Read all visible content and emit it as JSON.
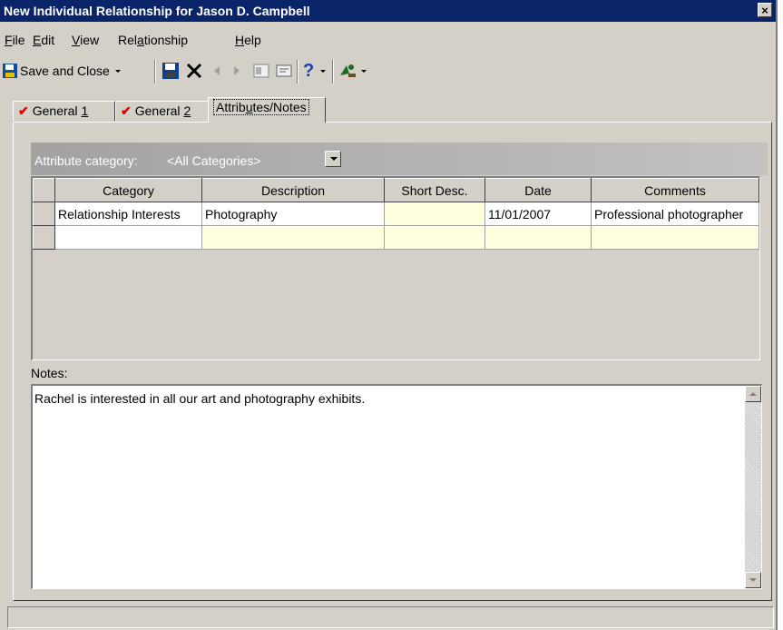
{
  "window": {
    "title": "New Individual Relationship for Jason D. Campbell",
    "close_glyph": "×"
  },
  "menu": [
    {
      "label": "File",
      "u": "F",
      "rest": "ile"
    },
    {
      "label": "Edit",
      "u": "E",
      "rest": "dit"
    },
    {
      "label": "View",
      "u": "V",
      "rest": "iew"
    },
    {
      "label": "Relationship",
      "pre": "Rel",
      "u": "a",
      "rest": "tionship"
    },
    {
      "label": "Help",
      "u": "H",
      "rest": "elp"
    }
  ],
  "toolbar": {
    "save_close_label": "Save and Close",
    "help_glyph": "?"
  },
  "tabs": [
    {
      "label": "General 1",
      "pre": "General ",
      "u": "1"
    },
    {
      "label": "General 2",
      "pre": "General ",
      "u": "2"
    },
    {
      "label": "Attributes/Notes",
      "pre": "Attrib",
      "u": "u",
      "rest": "tes/Notes"
    }
  ],
  "attributes": {
    "category_label": "Attribute category:",
    "category_value": "<All Categories>",
    "columns": [
      "Category",
      "Description",
      "Short Desc.",
      "Date",
      "Comments"
    ],
    "rows": [
      {
        "category": "Relationship Interests",
        "description": "Photography",
        "short_desc": "",
        "date": "11/01/2007",
        "comments": "Professional photographer"
      },
      {
        "category": "",
        "description": "",
        "short_desc": "",
        "date": "",
        "comments": ""
      }
    ]
  },
  "notes": {
    "label": "Notes:",
    "text": "Rachel is interested in all our art and photography exhibits."
  },
  "colors": {
    "title_bar": "#0a246a",
    "face": "#d4d0c8",
    "required_check": "#e00000",
    "new_row": "#ffffe0"
  }
}
